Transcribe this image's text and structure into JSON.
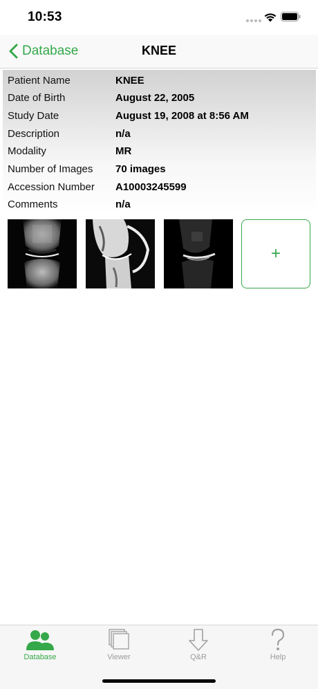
{
  "status": {
    "time": "10:53"
  },
  "nav": {
    "back_label": "Database",
    "title": "KNEE"
  },
  "patient": {
    "rows": [
      {
        "label": "Patient Name",
        "value": "KNEE"
      },
      {
        "label": "Date of Birth",
        "value": "August 22, 2005"
      },
      {
        "label": "Study Date",
        "value": "August 19, 2008 at 8:56 AM"
      },
      {
        "label": "Description",
        "value": "n/a"
      },
      {
        "label": "Modality",
        "value": "MR"
      },
      {
        "label": "Number of Images",
        "value": "70 images"
      },
      {
        "label": "Accession Number",
        "value": "A10003245599"
      },
      {
        "label": "Comments",
        "value": "n/a"
      }
    ]
  },
  "thumbnails": {
    "add_label": "+"
  },
  "tabs": [
    {
      "label": "Database",
      "icon": "people-icon",
      "active": true
    },
    {
      "label": "Viewer",
      "icon": "stacked-pages-icon",
      "active": false
    },
    {
      "label": "Q&R",
      "icon": "download-arrow-icon",
      "active": false
    },
    {
      "label": "Help",
      "icon": "question-mark-icon",
      "active": false
    }
  ],
  "colors": {
    "accent": "#35a84a",
    "tab_inactive": "#9a9a9a"
  }
}
